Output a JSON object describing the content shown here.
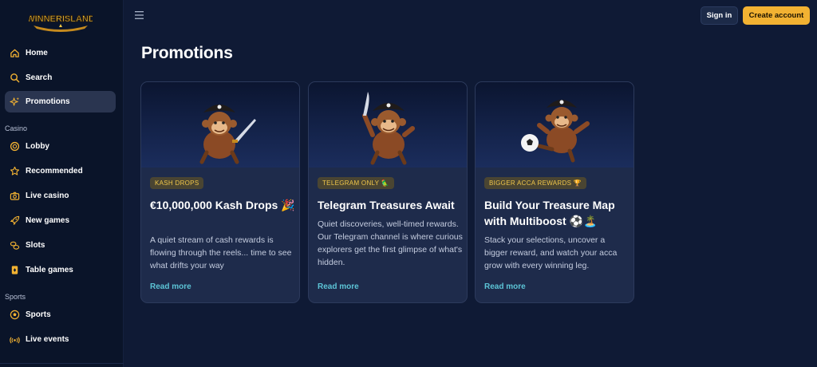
{
  "brand": {
    "name": "WINNERISLAND"
  },
  "topbar": {
    "signin_label": "Sign in",
    "create_label": "Create account"
  },
  "sidebar": {
    "items": [
      {
        "label": "Home",
        "icon": "home-icon"
      },
      {
        "label": "Search",
        "icon": "search-icon"
      },
      {
        "label": "Promotions",
        "icon": "sparkles-icon",
        "active": true
      }
    ],
    "casino_label": "Casino",
    "casino_items": [
      {
        "label": "Lobby",
        "icon": "lobby-icon"
      },
      {
        "label": "Recommended",
        "icon": "star-icon"
      },
      {
        "label": "Live casino",
        "icon": "camera-icon"
      },
      {
        "label": "New games",
        "icon": "rocket-icon"
      },
      {
        "label": "Slots",
        "icon": "coins-icon"
      },
      {
        "label": "Table games",
        "icon": "cards-icon"
      }
    ],
    "sports_label": "Sports",
    "sports_items": [
      {
        "label": "Sports",
        "icon": "soccer-ball-icon"
      },
      {
        "label": "Live events",
        "icon": "live-signal-icon"
      }
    ]
  },
  "main": {
    "title": "Promotions",
    "cards": [
      {
        "badge": "KASH DROPS",
        "title": "€10,000,000 Kash Drops 🎉",
        "description": "A quiet stream of cash rewards is flowing through the reels... time to see what drifts your way",
        "link": "Read more"
      },
      {
        "badge": "TELEGRAM ONLY 🦜",
        "title": "Telegram Treasures Await",
        "description": "Quiet discoveries, well-timed rewards. Our Telegram channel is where curious explorers get the first glimpse of what's hidden.",
        "link": "Read more"
      },
      {
        "badge": "BIGGER ACCA REWARDS 🏆",
        "title": "Build Your Treasure Map with Multiboost ⚽🏝️",
        "description": "Stack your selections, uncover a bigger reward, and watch your acca grow with every winning leg.",
        "link": "Read more"
      }
    ]
  },
  "colors": {
    "background": "#0f1a35",
    "sidebar": "#0a1429",
    "accent": "#f2b232",
    "link": "#5cc4d6",
    "badge_text": "#f0c64a"
  }
}
